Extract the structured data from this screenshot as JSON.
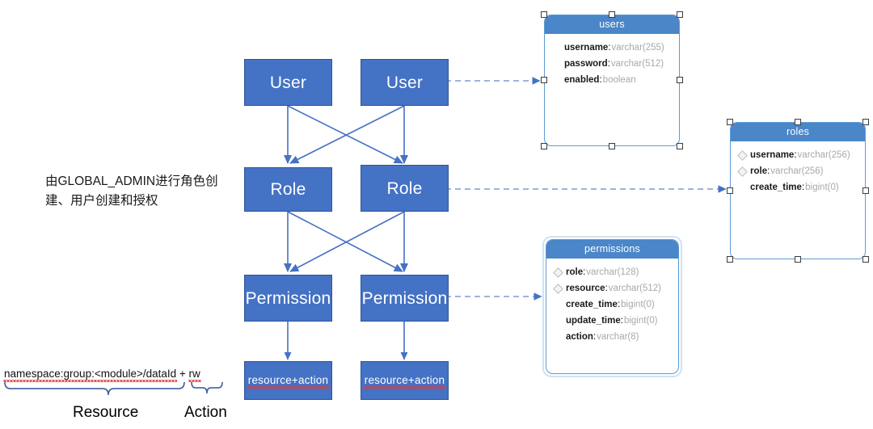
{
  "diagram": {
    "note": "由GLOBAL_ADMIN进行角色创建、用户创建和授权",
    "flow": {
      "user_left": "User",
      "user_right": "User",
      "role_left": "Role",
      "role_right": "Role",
      "permission_left": "Permission",
      "permission_right": "Permission",
      "resource_action_left": "resource+action",
      "resource_action_right": "resource+action"
    },
    "expression": {
      "text": "namespace:group:<module>/dataId + rw",
      "resource_part": "namespace:group:<module>/dataId",
      "action_part": "rw",
      "resource_label": "Resource",
      "action_label": "Action"
    },
    "colors": {
      "box_fill": "#4472C4",
      "box_border": "#2f5597",
      "arrow": "#4472C4",
      "dashed_connector": "#8faadc",
      "table_header": "#4a86c8",
      "table_border": "#5b9bd5",
      "field_type": "#a6a8ab",
      "squiggle": "#e03a3a"
    },
    "tables": [
      {
        "name": "users",
        "selected": true,
        "fields": [
          {
            "name": "username",
            "type": "varchar(255)",
            "key": false
          },
          {
            "name": "password",
            "type": "varchar(512)",
            "key": false
          },
          {
            "name": "enabled",
            "type": "boolean",
            "key": false
          }
        ]
      },
      {
        "name": "roles",
        "selected": true,
        "fields": [
          {
            "name": "username",
            "type": "varchar(256)",
            "key": true
          },
          {
            "name": "role",
            "type": "varchar(256)",
            "key": true
          },
          {
            "name": "create_time",
            "type": "bigint(0)",
            "key": false
          }
        ]
      },
      {
        "name": "permissions",
        "selected": false,
        "fields": [
          {
            "name": "role",
            "type": "varchar(128)",
            "key": true
          },
          {
            "name": "resource",
            "type": "varchar(512)",
            "key": true
          },
          {
            "name": "create_time",
            "type": "bigint(0)",
            "key": false
          },
          {
            "name": "update_time",
            "type": "bigint(0)",
            "key": false
          },
          {
            "name": "action",
            "type": "varchar(8)",
            "key": false
          }
        ]
      }
    ]
  }
}
